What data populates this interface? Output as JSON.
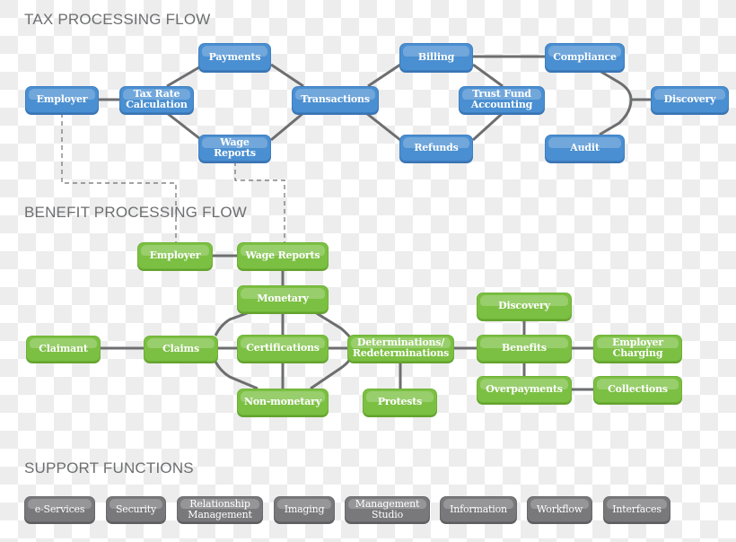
{
  "sections": {
    "tax": "TAX PROCESSING FLOW",
    "benefit": "BENEFIT PROCESSING FLOW",
    "support": "SUPPORT FUNCTIONS"
  },
  "colors": {
    "tax": "#4a8fd1",
    "benefit": "#7cc043",
    "support": "#79797b",
    "connector": "#6d6e70"
  },
  "tax_flow": {
    "nodes": [
      {
        "id": "employer",
        "label": "Employer"
      },
      {
        "id": "tax-rate-calculation",
        "label": "Tax Rate\nCalculation"
      },
      {
        "id": "payments",
        "label": "Payments"
      },
      {
        "id": "wage-reports",
        "label": "Wage\nReports"
      },
      {
        "id": "transactions",
        "label": "Transactions"
      },
      {
        "id": "billing",
        "label": "Billing"
      },
      {
        "id": "refunds",
        "label": "Refunds"
      },
      {
        "id": "trust-fund-accounting",
        "label": "Trust Fund\nAccounting"
      },
      {
        "id": "compliance",
        "label": "Compliance"
      },
      {
        "id": "audit",
        "label": "Audit"
      },
      {
        "id": "discovery",
        "label": "Discovery"
      }
    ],
    "links": [
      [
        "employer",
        "tax-rate-calculation"
      ],
      [
        "tax-rate-calculation",
        "payments"
      ],
      [
        "tax-rate-calculation",
        "wage-reports"
      ],
      [
        "payments",
        "transactions"
      ],
      [
        "wage-reports",
        "transactions"
      ],
      [
        "transactions",
        "billing"
      ],
      [
        "transactions",
        "refunds"
      ],
      [
        "billing",
        "trust-fund-accounting"
      ],
      [
        "refunds",
        "trust-fund-accounting"
      ],
      [
        "billing",
        "compliance"
      ],
      [
        "compliance",
        "discovery"
      ],
      [
        "audit",
        "discovery"
      ]
    ]
  },
  "benefit_flow": {
    "nodes": [
      {
        "id": "employer",
        "label": "Employer"
      },
      {
        "id": "wage-reports",
        "label": "Wage Reports"
      },
      {
        "id": "monetary",
        "label": "Monetary"
      },
      {
        "id": "claimant",
        "label": "Claimant"
      },
      {
        "id": "claims",
        "label": "Claims"
      },
      {
        "id": "certifications",
        "label": "Certifications"
      },
      {
        "id": "non-monetary",
        "label": "Non-monetary"
      },
      {
        "id": "determinations",
        "label": "Determinations/\nRedeterminations"
      },
      {
        "id": "protests",
        "label": "Protests"
      },
      {
        "id": "discovery",
        "label": "Discovery"
      },
      {
        "id": "benefits",
        "label": "Benefits"
      },
      {
        "id": "overpayments",
        "label": "Overpayments"
      },
      {
        "id": "employer-charging",
        "label": "Employer\nCharging"
      },
      {
        "id": "collections",
        "label": "Collections"
      }
    ],
    "links": [
      [
        "employer",
        "wage-reports"
      ],
      [
        "wage-reports",
        "monetary"
      ],
      [
        "monetary",
        "certifications"
      ],
      [
        "certifications",
        "non-monetary"
      ],
      [
        "claimant",
        "claims"
      ],
      [
        "claims",
        "certifications"
      ],
      [
        "claims",
        "monetary"
      ],
      [
        "claims",
        "non-monetary"
      ],
      [
        "monetary",
        "determinations"
      ],
      [
        "certifications",
        "determinations"
      ],
      [
        "non-monetary",
        "determinations"
      ],
      [
        "determinations",
        "protests"
      ],
      [
        "determinations",
        "benefits"
      ],
      [
        "discovery",
        "benefits"
      ],
      [
        "benefits",
        "overpayments"
      ],
      [
        "benefits",
        "employer-charging"
      ],
      [
        "overpayments",
        "collections"
      ]
    ]
  },
  "cross_links": [
    [
      "tax.employer",
      "benefit.employer"
    ],
    [
      "tax.wage-reports",
      "benefit.wage-reports"
    ]
  ],
  "support_functions": [
    {
      "id": "e-services",
      "label": "e-Services"
    },
    {
      "id": "security",
      "label": "Security"
    },
    {
      "id": "relationship-management",
      "label": "Relationship\nManagement"
    },
    {
      "id": "imaging",
      "label": "Imaging"
    },
    {
      "id": "management-studio",
      "label": "Management\nStudio"
    },
    {
      "id": "information",
      "label": "Information"
    },
    {
      "id": "workflow",
      "label": "Workflow"
    },
    {
      "id": "interfaces",
      "label": "Interfaces"
    }
  ]
}
